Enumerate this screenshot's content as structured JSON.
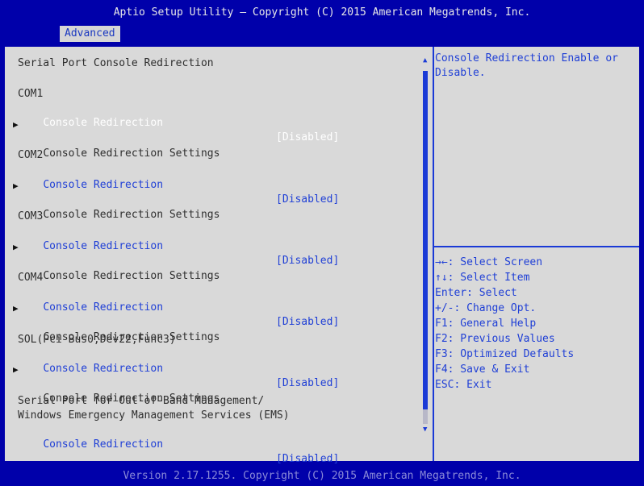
{
  "header": {
    "title": "Aptio Setup Utility – Copyright (C) 2015 American Megatrends, Inc.",
    "active_tab": "Advanced"
  },
  "main": {
    "items": [
      {
        "text": "Serial Port Console Redirection",
        "type": "heading"
      },
      {
        "text": "COM1",
        "type": "heading"
      },
      {
        "text": "Console Redirection",
        "value": "[Disabled]",
        "type": "option",
        "selected": true
      },
      {
        "text": "Console Redirection Settings",
        "type": "submenu"
      },
      {
        "text": "COM2",
        "type": "heading"
      },
      {
        "text": "Console Redirection",
        "value": "[Disabled]",
        "type": "option"
      },
      {
        "text": "Console Redirection Settings",
        "type": "submenu"
      },
      {
        "text": "COM3",
        "type": "heading"
      },
      {
        "text": "Console Redirection",
        "value": "[Disabled]",
        "type": "option"
      },
      {
        "text": "Console Redirection Settings",
        "type": "submenu"
      },
      {
        "text": "COM4",
        "type": "heading"
      },
      {
        "text": "Console Redirection",
        "value": "[Disabled]",
        "type": "option"
      },
      {
        "text": "Console Redirection Settings",
        "type": "submenu"
      },
      {
        "text": "SOL(Pci Bus0,Dev22,Func3)",
        "type": "heading"
      },
      {
        "text": "Console Redirection",
        "value": "[Disabled]",
        "type": "option"
      },
      {
        "text": "Console Redirection Settings",
        "type": "submenu"
      },
      {
        "text": "Serial Port for Out-of-Band Management/",
        "type": "heading"
      },
      {
        "text": "Windows Emergency Management Services (EMS)",
        "type": "heading"
      },
      {
        "text": "Console Redirection",
        "value": "[Disabled]",
        "type": "option"
      }
    ]
  },
  "help": {
    "description": "Console Redirection Enable or\nDisable.",
    "keys": [
      "→←: Select Screen",
      "↑↓: Select Item",
      "Enter: Select",
      "+/-: Change Opt.",
      "F1: General Help",
      "F2: Previous Values",
      "F3: Optimized Defaults",
      "F4: Save & Exit",
      "ESC: Exit"
    ]
  },
  "footer": {
    "text": "Version 2.17.1255. Copyright (C) 2015 American Megatrends, Inc."
  },
  "colors": {
    "background": "#0000aa",
    "panel": "#d9d9d9",
    "accent": "#1a3ad6",
    "selected_text": "#ffffff"
  }
}
